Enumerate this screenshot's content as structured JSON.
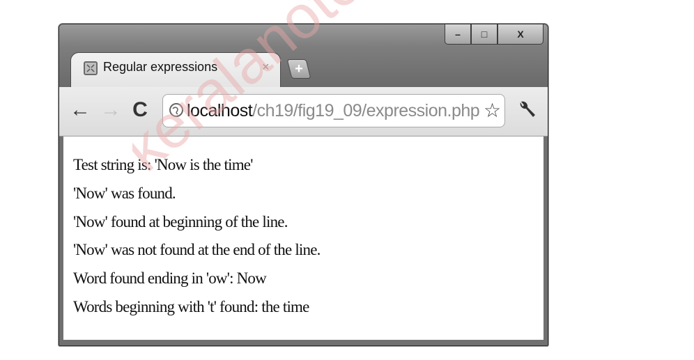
{
  "watermark": {
    "text": "keralanotes"
  },
  "tab": {
    "title": "Regular expressions",
    "close_glyph": "×",
    "favicon": "page-icon"
  },
  "new_tab": {
    "glyph": "+"
  },
  "window_controls": {
    "minimize": "–",
    "maximize": "□",
    "close": "X"
  },
  "nav": {
    "back": "←",
    "forward": "→",
    "reload": "C"
  },
  "address_bar": {
    "host": "localhost",
    "path": "/ch19/fig19_09/expression.php"
  },
  "bookmark_star": "☆",
  "content": {
    "lines": [
      "Test string is: 'Now is the time'",
      "'Now' was found.",
      "'Now' found at beginning of the line.",
      "'Now' was not found at the end of the line.",
      "Word found ending in 'ow': Now",
      "Words beginning with 't' found: the time"
    ]
  },
  "colors": {
    "frame": "#707070",
    "toolbar": "#e4e4e4",
    "text": "#111111"
  }
}
